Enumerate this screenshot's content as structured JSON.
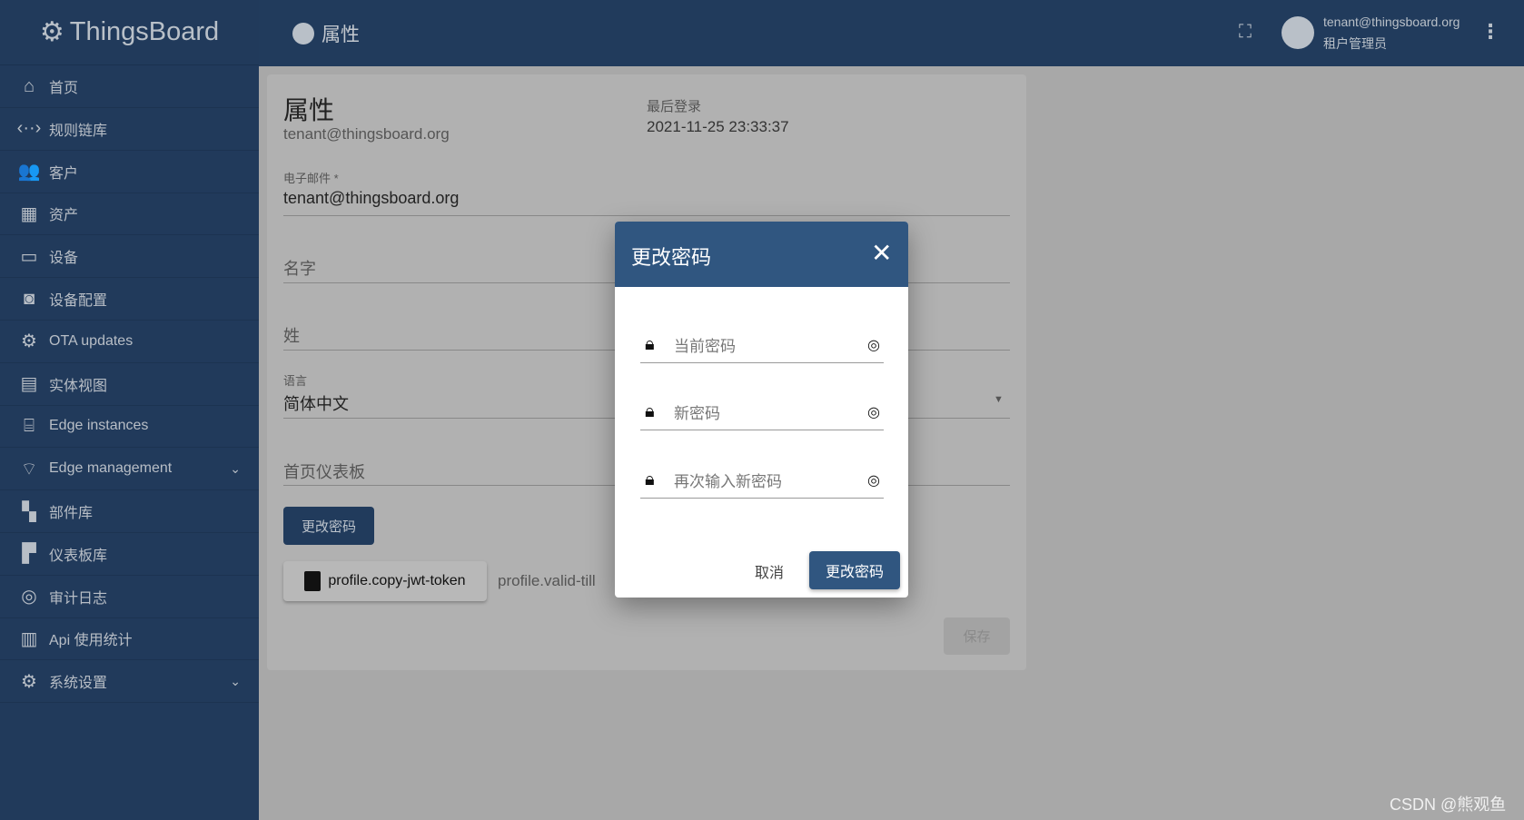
{
  "app": {
    "name": "ThingsBoard"
  },
  "header": {
    "title": "属性",
    "user_email": "tenant@thingsboard.org",
    "user_role": "租户管理员"
  },
  "sidebar": {
    "items": [
      {
        "label": "首页",
        "icon": "home-icon",
        "glyph": "⌂"
      },
      {
        "label": "规则链库",
        "icon": "code-arrows-icon",
        "glyph": "‹··›"
      },
      {
        "label": "客户",
        "icon": "people-icon",
        "glyph": "👥"
      },
      {
        "label": "资产",
        "icon": "building-icon",
        "glyph": "▦"
      },
      {
        "label": "设备",
        "icon": "devices-icon",
        "glyph": "▭"
      },
      {
        "label": "设备配置",
        "icon": "device-profile-icon",
        "glyph": "◙"
      },
      {
        "label": "OTA updates",
        "icon": "chip-icon",
        "glyph": "⚙"
      },
      {
        "label": "实体视图",
        "icon": "view-icon",
        "glyph": "▤"
      },
      {
        "label": "Edge instances",
        "icon": "router-icon",
        "glyph": "⌸"
      },
      {
        "label": "Edge management",
        "icon": "antenna-icon",
        "glyph": "⌔",
        "expandable": true
      },
      {
        "label": "部件库",
        "icon": "widgets-icon",
        "glyph": "▚"
      },
      {
        "label": "仪表板库",
        "icon": "dashboard-icon",
        "glyph": "▛"
      },
      {
        "label": "审计日志",
        "icon": "track-changes-icon",
        "glyph": "◎"
      },
      {
        "label": "Api 使用统计",
        "icon": "chart-icon",
        "glyph": "▥"
      },
      {
        "label": "系统设置",
        "icon": "settings-icon",
        "glyph": "⚙",
        "expandable": true
      }
    ]
  },
  "profile": {
    "title": "属性",
    "subtitle": "tenant@thingsboard.org",
    "last_login_label": "最后登录",
    "last_login_value": "2021-11-25 23:33:37",
    "email_label": "电子邮件 *",
    "email_value": "tenant@thingsboard.org",
    "first_name_placeholder": "名字",
    "last_name_placeholder": "姓",
    "language_label": "语言",
    "language_value": "简体中文",
    "home_dashboard_placeholder": "首页仪表板",
    "change_password_button": "更改密码",
    "copy_jwt_button": "profile.copy-jwt-token",
    "valid_till": "profile.valid-till",
    "save_button": "保存"
  },
  "dialog": {
    "title": "更改密码",
    "current_password_placeholder": "当前密码",
    "new_password_placeholder": "新密码",
    "repeat_password_placeholder": "再次输入新密码",
    "cancel_button": "取消",
    "submit_button": "更改密码"
  },
  "watermark": "CSDN @熊观鱼",
  "colors": {
    "primary": "#305680",
    "sidebar": "#213a5b"
  }
}
